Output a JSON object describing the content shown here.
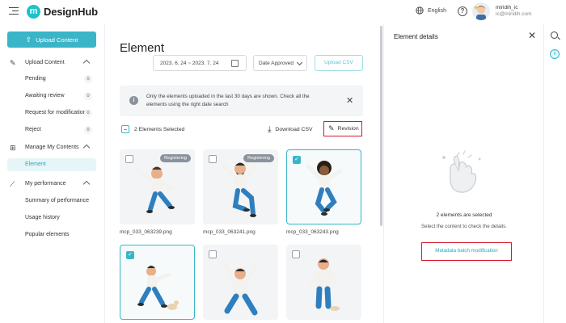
{
  "header": {
    "logo_text": "DesignHub",
    "logo_mark": "m",
    "language": "English",
    "help_glyph": "?",
    "user_name": "miridih_ic",
    "user_email": "ic@miridih.com"
  },
  "sidebar": {
    "upload_button": "Upload Content",
    "sections": [
      {
        "label": "Upload Content",
        "icon": "pencil-icon",
        "items": [
          {
            "label": "Pending",
            "count": "0"
          },
          {
            "label": "Awaiting review",
            "count": "0"
          },
          {
            "label": "Request for modification",
            "count": "0"
          },
          {
            "label": "Reject",
            "count": "0"
          }
        ]
      },
      {
        "label": "Manage My Contents",
        "icon": "grid-icon",
        "items": [
          {
            "label": "Element",
            "active": true
          }
        ]
      },
      {
        "label": "My performance",
        "icon": "chart-icon",
        "items": [
          {
            "label": "Summary of performance"
          },
          {
            "label": "Usage history"
          },
          {
            "label": "Popular elements"
          }
        ]
      }
    ]
  },
  "main": {
    "title": "Element",
    "date_range": "2023. 6. 24 ~ 2023. 7. 24",
    "sort": "Date Approved",
    "upload_csv": "Upload CSV",
    "notice": "Only the elements uploaded in the last 30 days are shown. Check all the elements using the right date search",
    "selected_text": "2 Elements Selected",
    "download_csv": "Download CSV",
    "revision": "Revision",
    "cards": [
      {
        "badge": "Registering",
        "checked": false,
        "filename": "mcp_033_063239.png"
      },
      {
        "badge": "Registering",
        "checked": false,
        "filename": "mcp_033_063241.png"
      },
      {
        "badge": "",
        "checked": true,
        "filename": "mcp_033_063243.png"
      },
      {
        "badge": "",
        "checked": true,
        "filename": ""
      },
      {
        "badge": "",
        "checked": false,
        "filename": ""
      },
      {
        "badge": "",
        "checked": false,
        "filename": ""
      }
    ]
  },
  "details": {
    "title": "Element details",
    "selected_msg": "2 elements are selected",
    "hint": "Select the content to check the details.",
    "batch_button": "Metadata batch modification"
  },
  "colors": {
    "accent": "#3ab5c7",
    "highlight": "#d8192a",
    "badge": "#8a929b"
  }
}
